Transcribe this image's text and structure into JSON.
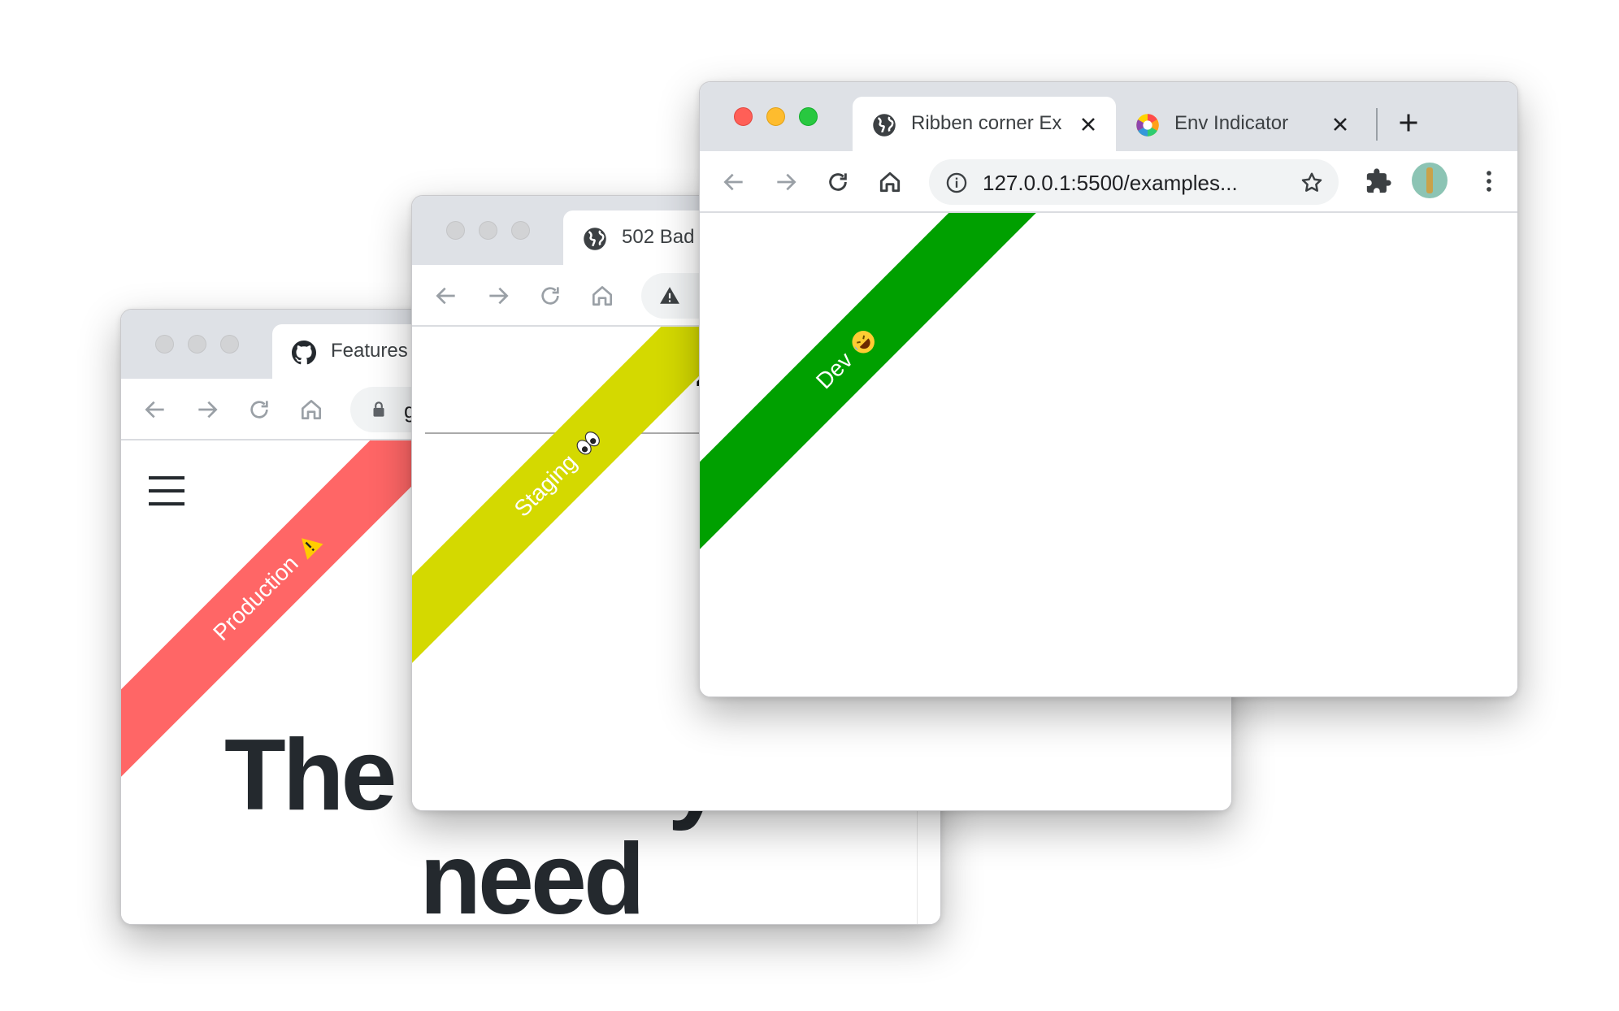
{
  "windows": {
    "production": {
      "tab_title": "Features",
      "omnibox_text": "g",
      "ribbon_label": "Production",
      "ribbon_color": "#ff6666",
      "heading_line1": "The tools you",
      "heading_line2": "need"
    },
    "staging": {
      "tab_title": "502 Bad",
      "page_heading": "502",
      "ribbon_label": "Staging",
      "ribbon_color": "#d4d900"
    },
    "dev": {
      "tab1_title": "Ribben corner Ex",
      "tab2_title": "Env Indicator",
      "url": "127.0.0.1:5500/examples...",
      "ribbon_label": "Dev",
      "ribbon_color": "#00a000"
    }
  },
  "colors": {
    "close": "#ff5f57",
    "minimize": "#febc2e",
    "maximize": "#28c840",
    "inactive_light": "#d2d3d5",
    "tabstrip": "#dee1e6"
  },
  "icons": [
    "back-arrow-icon",
    "forward-arrow-icon",
    "reload-icon",
    "home-icon",
    "lock-icon",
    "warning-icon",
    "info-icon",
    "star-icon",
    "extensions-icon",
    "profile-avatar-icon",
    "menu-dots-icon",
    "globe-icon",
    "github-icon",
    "color-wheel-icon",
    "close-icon",
    "plus-icon",
    "hamburger-icon"
  ]
}
